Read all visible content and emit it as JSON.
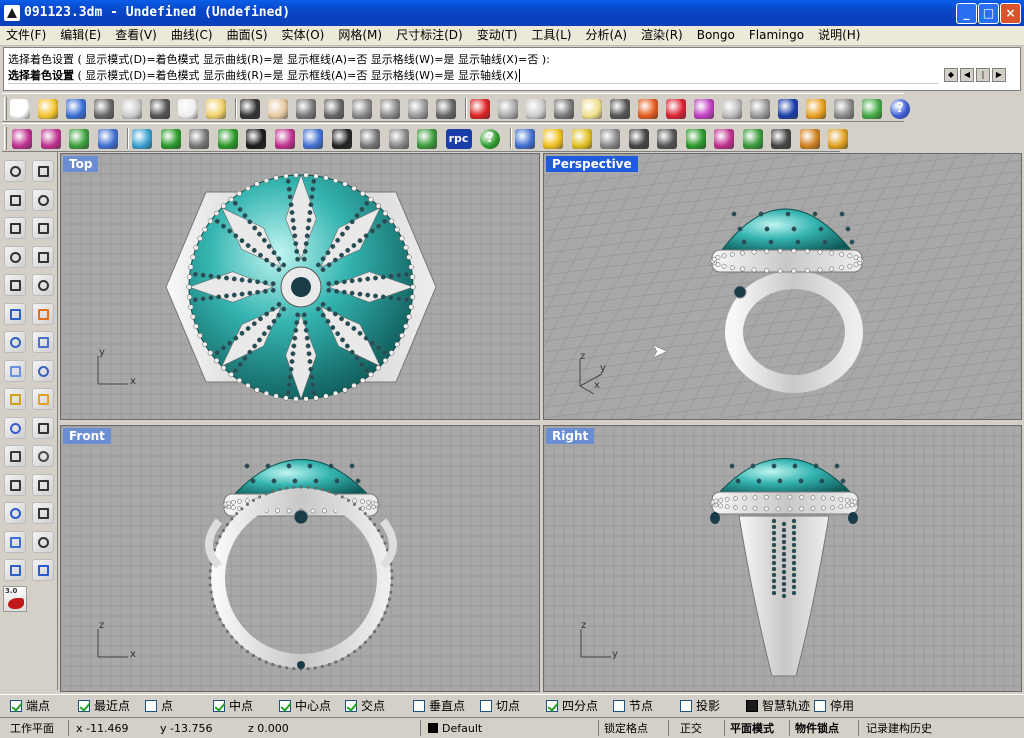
{
  "window": {
    "title": "091123.3dm - Undefined (Undefined)",
    "min_label": "_",
    "max_label": "□",
    "close_label": "×"
  },
  "menu": {
    "items": [
      "文件(F)",
      "编辑(E)",
      "查看(V)",
      "曲线(C)",
      "曲面(S)",
      "实体(O)",
      "网格(M)",
      "尺寸标注(D)",
      "变动(T)",
      "工具(L)",
      "分析(A)",
      "渲染(R)",
      "Bongo",
      "Flamingo",
      "说明(H)"
    ]
  },
  "command": {
    "history": "选择着色设置 ( 显示模式(D)=着色模式  显示曲线(R)=是  显示框线(A)=否  显示格线(W)=是  显示轴线(X)=否 ):",
    "prompt_label": "选择着色设置",
    "prompt_options": " ( 显示模式(D)=着色模式  显示曲线(R)=是  显示框线(A)=否  显示格线(W)=是  显示轴线(X)"
  },
  "toolbar": {
    "badge_rpc": "rpc",
    "badge_help": "?",
    "version_label": "3.0"
  },
  "viewports": {
    "top": {
      "title": "Top",
      "axis_a": "y",
      "axis_b": "x"
    },
    "perspective": {
      "title": "Perspective",
      "axis_a": "z",
      "axis_b": "y",
      "axis_c": "x"
    },
    "front": {
      "title": "Front",
      "axis_a": "z",
      "axis_b": "x"
    },
    "right": {
      "title": "Right",
      "axis_a": "z",
      "axis_b": "y"
    }
  },
  "osnaps": [
    {
      "label": "端点",
      "checked": true
    },
    {
      "label": "最近点",
      "checked": true
    },
    {
      "label": "点",
      "checked": false
    },
    {
      "label": "中点",
      "checked": true
    },
    {
      "label": "中心点",
      "checked": true
    },
    {
      "label": "交点",
      "checked": true
    },
    {
      "label": "垂直点",
      "checked": false
    },
    {
      "label": "切点",
      "checked": false
    },
    {
      "label": "四分点",
      "checked": true
    },
    {
      "label": "节点",
      "checked": false
    },
    {
      "label": "投影",
      "checked": false
    },
    {
      "label": "智慧轨迹",
      "checked": "filled"
    },
    {
      "label": "停用",
      "checked": false
    }
  ],
  "status": {
    "cplane": "工作平面",
    "x": "x -11.469",
    "y": "y -13.756",
    "z": "z 0.000",
    "layer": "Default",
    "grid_snap": "锁定格点",
    "ortho": "正交",
    "planar": "平面模式",
    "osnap": "物件锁点",
    "history": "记录建构历史"
  },
  "colors": {
    "stone": "#2fa8a8",
    "metal": "#e6e6e6",
    "viewport_bg": "#a8a8a8",
    "grid": "#9a9a9a",
    "active_tab": "#1f5bdc",
    "inactive_tab": "#6b8ed3"
  }
}
